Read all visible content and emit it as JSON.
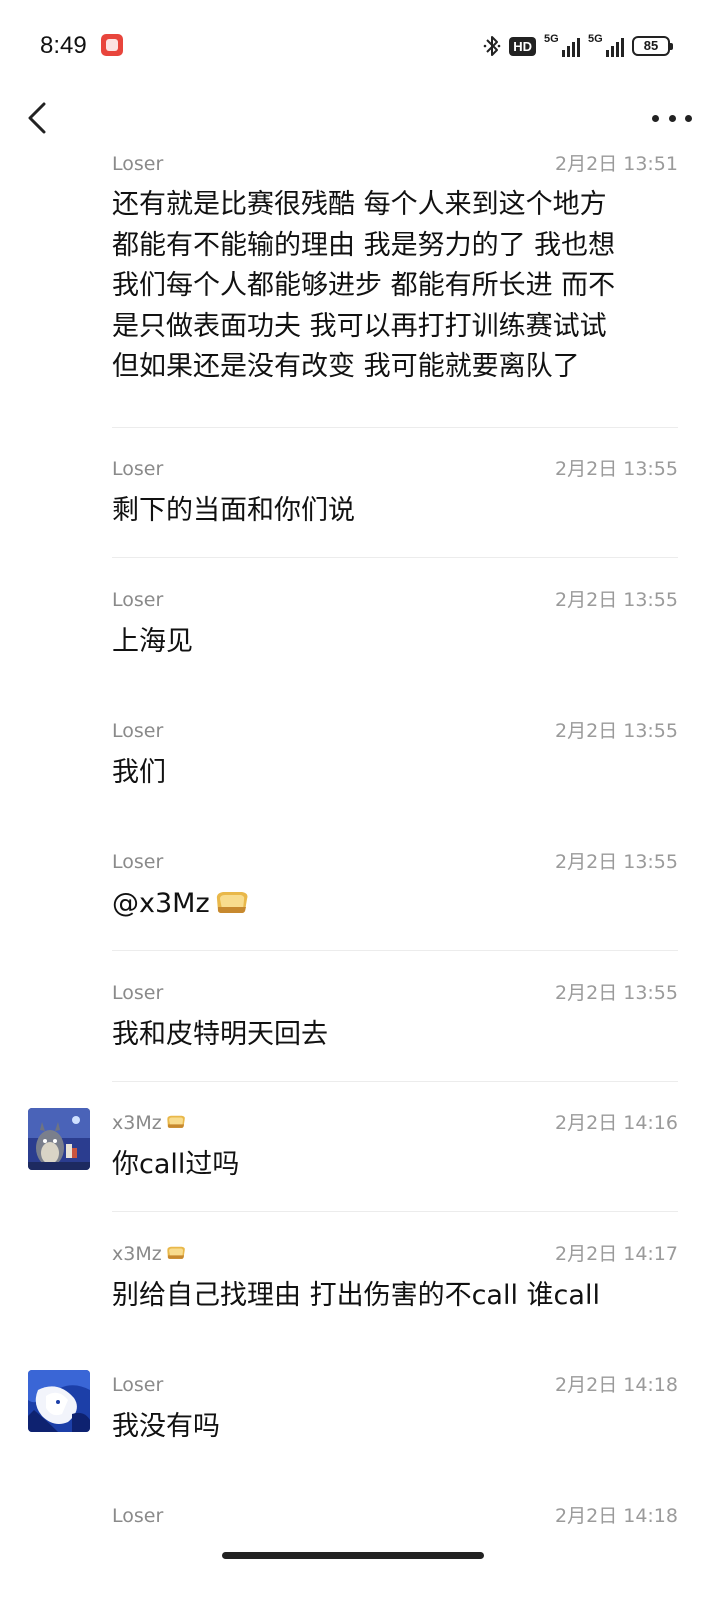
{
  "status_bar": {
    "time": "8:49",
    "hd_label": "HD",
    "network_1": "5G",
    "network_2": "5G",
    "battery": "85"
  },
  "nav": {
    "back_icon": "chevron-left-icon",
    "more_icon": "more-horizontal-icon"
  },
  "messages": [
    {
      "sender": "Loser",
      "time": "2月2日 13:51",
      "lines": [
        "还有就是比赛很残酷 每个人来到这个地方",
        "都能有不能输的理由 我是努力的了 我也想",
        "我们每个人都能够进步 都能有所长进 而不",
        "是只做表面功夫 我可以再打打训练赛试试",
        "但如果还是没有改变 我可能就要离队了"
      ]
    },
    {
      "sender": "Loser",
      "time": "2月2日 13:55",
      "text": "剩下的当面和你们说"
    },
    {
      "sender": "Loser",
      "time": "2月2日 13:55",
      "text": "上海见"
    },
    {
      "sender": "Loser",
      "time": "2月2日 13:55",
      "text": "我们"
    },
    {
      "sender": "Loser",
      "time": "2月2日 13:55",
      "text": "@x3Mz"
    },
    {
      "sender": "Loser",
      "time": "2月2日 13:55",
      "text": "我和皮特明天回去"
    },
    {
      "sender": "x3Mz",
      "time": "2月2日 14:16",
      "text": "你call过吗"
    },
    {
      "sender": "x3Mz",
      "time": "2月2日 14:17",
      "text": "别给自己找理由 打出伤害的不call 谁call"
    },
    {
      "sender": "Loser",
      "time": "2月2日 14:18",
      "text": "我没有吗"
    },
    {
      "sender": "Loser",
      "time": "2月2日 14:18",
      "text": ""
    }
  ],
  "colors": {
    "background": "#ffffff",
    "text": "#111111",
    "meta": "#8a8a8a",
    "divider": "#ececec"
  }
}
